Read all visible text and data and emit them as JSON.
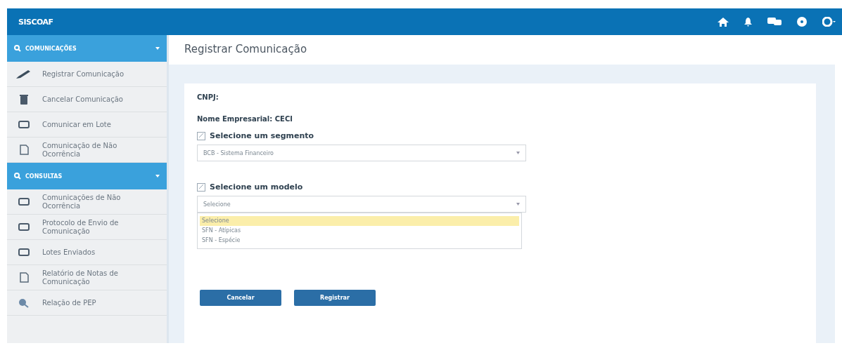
{
  "header": {
    "title": "SISCOAF"
  },
  "sidebar": {
    "sections": [
      {
        "title": "COMUNICAÇÕES",
        "expanded": true,
        "items": [
          {
            "label": "Registrar Comunicação",
            "kind": "pencil"
          },
          {
            "label": "Cancelar Comunicação",
            "kind": "trash"
          },
          {
            "label": "Comunicar em Lote",
            "kind": "card"
          },
          {
            "label": "Comunicação de Não Ocorrência",
            "kind": "doc"
          }
        ]
      },
      {
        "title": "CONSULTAS",
        "expanded": true,
        "items": [
          {
            "label": "Comunicações de Não Ocorrência",
            "kind": "card"
          },
          {
            "label": "Protocolo de Envio de Comunicação",
            "kind": "card"
          },
          {
            "label": "Lotes Enviados",
            "kind": "card"
          },
          {
            "label": "Relatório de Notas de Comunicação",
            "kind": "doc"
          },
          {
            "label": "Relação de PEP",
            "kind": "search"
          }
        ]
      }
    ]
  },
  "page": {
    "title": "Registrar Comunicação"
  },
  "form": {
    "cnpj_label": "CNPJ:",
    "company_label": "Nome Empresarial: CECI",
    "segment": {
      "label": "Selecione um segmento",
      "value": "BCB - Sistema Financeiro"
    },
    "model": {
      "label": "Selecione um modelo",
      "value": "Selecione",
      "expanded": true,
      "options": [
        {
          "label": "Selecione",
          "selected": true
        },
        {
          "label": "SFN - Atípicas",
          "selected": false
        },
        {
          "label": "SFN - Espécie",
          "selected": false
        }
      ]
    },
    "buttons": [
      {
        "label": "Cancelar"
      },
      {
        "label": "Registrar"
      }
    ]
  }
}
